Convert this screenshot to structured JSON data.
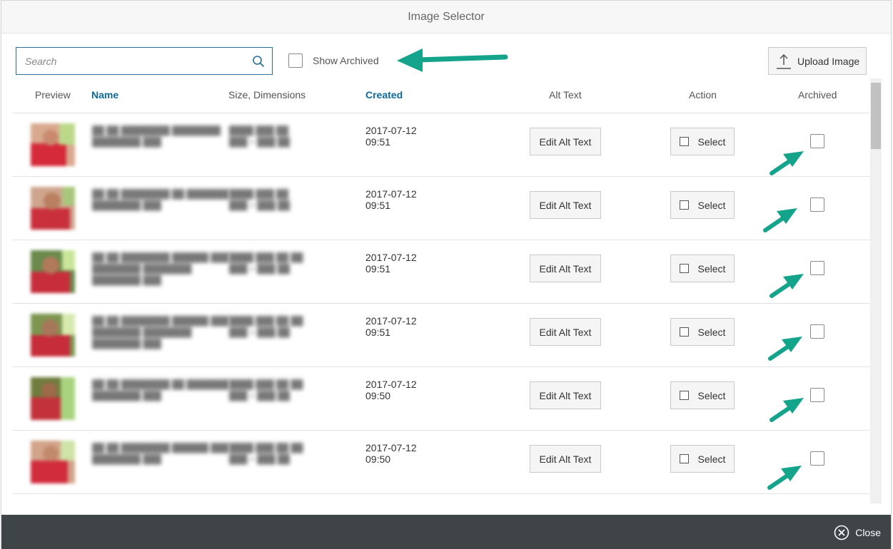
{
  "dialog": {
    "title": "Image Selector"
  },
  "toolbar": {
    "search_placeholder": "Search",
    "show_archived_label": "Show Archived",
    "upload_label": "Upload Image"
  },
  "columns": [
    "Preview",
    "Name",
    "Size, Dimensions",
    "Created",
    "Alt Text",
    "Action",
    "Archived"
  ],
  "rows": [
    {
      "created_date": "2017-07-12",
      "created_time": "09:51",
      "alt_button": "Edit Alt Text",
      "select_button": "Select"
    },
    {
      "created_date": "2017-07-12",
      "created_time": "09:51",
      "alt_button": "Edit Alt Text",
      "select_button": "Select"
    },
    {
      "created_date": "2017-07-12",
      "created_time": "09:51",
      "alt_button": "Edit Alt Text",
      "select_button": "Select"
    },
    {
      "created_date": "2017-07-12",
      "created_time": "09:51",
      "alt_button": "Edit Alt Text",
      "select_button": "Select"
    },
    {
      "created_date": "2017-07-12",
      "created_time": "09:50",
      "alt_button": "Edit Alt Text",
      "select_button": "Select"
    },
    {
      "created_date": "2017-07-12",
      "created_time": "09:50",
      "alt_button": "Edit Alt Text",
      "select_button": "Select"
    }
  ],
  "footer": {
    "close_label": "Close"
  },
  "colors": {
    "accent": "#0e6a9c",
    "annotation_arrow": "#14a38b",
    "footer_bg": "#3f4447"
  }
}
